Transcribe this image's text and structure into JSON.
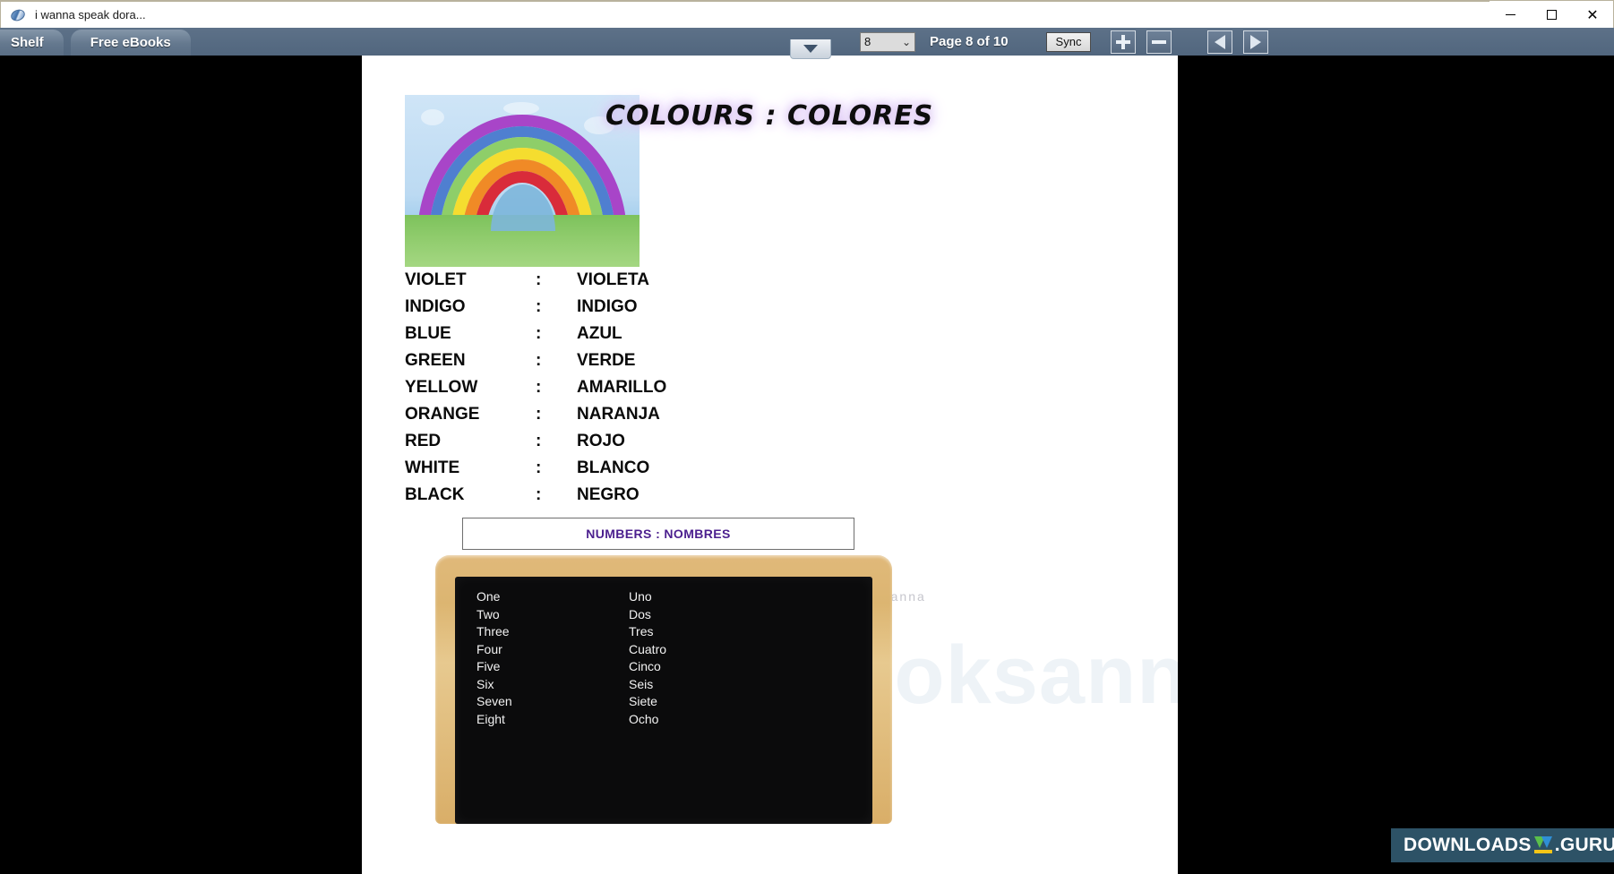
{
  "window": {
    "title": "i wanna speak dora...",
    "icon": "disc-icon",
    "controls": {
      "minimize": "—",
      "maximize": "☐",
      "close": "✕"
    }
  },
  "tabs": [
    {
      "label": "Shelf",
      "name": "tab-shelf",
      "active": false
    },
    {
      "label": "Free eBooks",
      "name": "tab-free-ebooks",
      "active": true
    }
  ],
  "toolbar": {
    "page_select_value": "8",
    "page_select_chevron": "⌄",
    "page_indicator": "Page 8 of 10",
    "sync_label": "Sync",
    "zoom_in_label": "+",
    "zoom_out_label": "−",
    "prev_label": "◀",
    "next_label": "▶",
    "collapse_label": "▼"
  },
  "page": {
    "heading": "COLOURS : COLORES",
    "artwork_alt": "watercolour-rainbow",
    "colours": [
      {
        "en": "VIOLET",
        "sep": ":",
        "es": "VIOLETA"
      },
      {
        "en": "INDIGO",
        "sep": ":",
        "es": "INDIGO"
      },
      {
        "en": "BLUE",
        "sep": ":",
        "es": "AZUL"
      },
      {
        "en": "GREEN",
        "sep": ":",
        "es": "VERDE"
      },
      {
        "en": "YELLOW",
        "sep": ":",
        "es": "AMARILLO"
      },
      {
        "en": "ORANGE",
        "sep": ":",
        "es": "NARANJA"
      },
      {
        "en": "RED",
        "sep": ":",
        "es": "ROJO"
      },
      {
        "en": "WHITE",
        "sep": ":",
        "es": "BLANCO"
      },
      {
        "en": "BLACK",
        "sep": ":",
        "es": "NEGRO"
      }
    ],
    "numbers_title": "NUMBERS : NOMBRES",
    "numbers": [
      {
        "en": "One",
        "es": "Uno"
      },
      {
        "en": "Two",
        "es": "Dos"
      },
      {
        "en": "Three",
        "es": "Tres"
      },
      {
        "en": "Four",
        "es": "Cuatro"
      },
      {
        "en": "Five",
        "es": "Cinco"
      },
      {
        "en": "Six",
        "es": "Seis"
      },
      {
        "en": "Seven",
        "es": "Siete"
      },
      {
        "en": "Eight",
        "es": "Ocho"
      }
    ],
    "watermark_large": "booksanna.com",
    "watermark_small": "downloaded from booksanna"
  },
  "badge": {
    "text_left": "DOWNLOADS",
    "text_right": ".GURU",
    "icon": "download-arrow-icon"
  },
  "colors": {
    "toolbar": "#51667e",
    "tab": "#64788e",
    "accent_purple": "#4b1f8e",
    "badge_bg": "#2d5266",
    "page_bg": "#ffffff",
    "viewport_bg": "#000000"
  }
}
